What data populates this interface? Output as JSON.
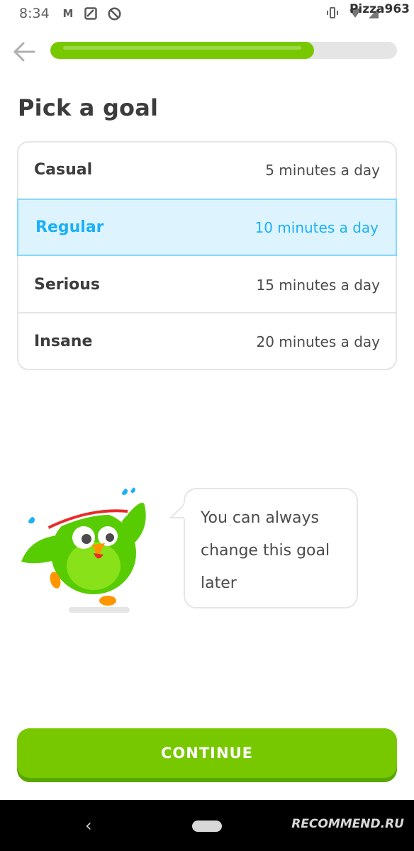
{
  "status_bar": {
    "time": "8:34",
    "left_icons": [
      "mail-m-icon",
      "image-icon",
      "no-sign-icon"
    ],
    "right_icons": [
      "vibrate-icon",
      "wifi-icon",
      "signal-icon"
    ],
    "watermark": "Pizza963"
  },
  "header": {
    "back_icon": "arrow-left-icon",
    "progress_fraction": 0.76
  },
  "page": {
    "title": "Pick a goal"
  },
  "goals": [
    {
      "name": "Casual",
      "time": "5 minutes a day",
      "selected": false
    },
    {
      "name": "Regular",
      "time": "10 minutes a day",
      "selected": true
    },
    {
      "name": "Serious",
      "time": "15 minutes a day",
      "selected": false
    },
    {
      "name": "Insane",
      "time": "20 minutes a day",
      "selected": false
    }
  ],
  "mascot": {
    "icon": "owl-mascot-icon"
  },
  "bubble": {
    "text": "You can always change this goal later"
  },
  "actions": {
    "continue_label": "CONTINUE"
  },
  "nav_bar": {
    "back_icon": "chevron-left-icon",
    "home_icon": "home-pill-icon",
    "watermark": "RECOMMEND.RU"
  },
  "colors": {
    "brand_green": "#78c800",
    "brand_green_dark": "#58a700",
    "selected_blue": "#1cb0f6",
    "selected_bg": "#ddf4ff",
    "selected_border": "#84d8ff",
    "border_gray": "#e5e5e5"
  }
}
